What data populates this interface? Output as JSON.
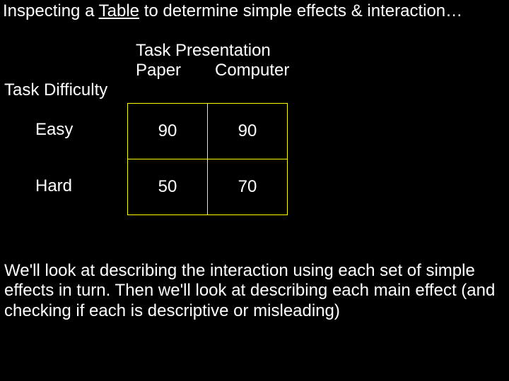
{
  "title": {
    "prefix": "Inspecting a ",
    "underlined": "Table",
    "suffix": " to determine simple effects & interaction…"
  },
  "factors": {
    "col_label": "Task Presentation",
    "col_levels": [
      "Paper",
      "Computer"
    ],
    "row_label": "Task Difficulty",
    "row_levels": [
      "Easy",
      "Hard"
    ]
  },
  "chart_data": {
    "type": "table",
    "row_categories": [
      "Easy",
      "Hard"
    ],
    "col_categories": [
      "Paper",
      "Computer"
    ],
    "values": [
      [
        90,
        90
      ],
      [
        50,
        70
      ]
    ],
    "row_factor": "Task Difficulty",
    "col_factor": "Task Presentation"
  },
  "body": "We'll look at describing the interaction using each set of simple effects in turn.  Then we'll look at describing each main effect (and checking if each is descriptive or misleading)"
}
